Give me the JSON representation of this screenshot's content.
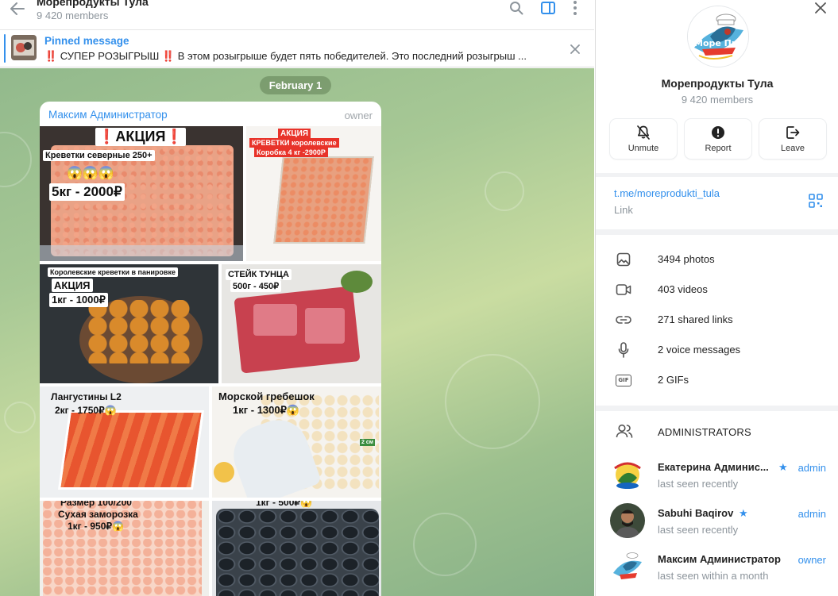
{
  "chat": {
    "title": "Морепродукты Тула",
    "members": "9 420 members",
    "pinned": {
      "title": "Pinned message",
      "text": "‼️ СУПЕР РОЗЫГРЫШ ‼️  В этом розыгрыше будет пять победителей.  Это последний розыгрыш ..."
    },
    "date": "February 1",
    "message": {
      "sender": "Максим Администратор",
      "role": "owner",
      "photos": {
        "p1": {
          "a": "❗АКЦИЯ❗",
          "b": "Креветки северные 250+",
          "c": "😱😱😱",
          "d": "5кг - 2000₽"
        },
        "p2": {
          "a": "АКЦИЯ",
          "b": "КРЕВЕТКИ королевские",
          "c": "Коробка 4 кг -2900Р"
        },
        "p3": {
          "a": "Королевские креветки в панировке",
          "b": "АКЦИЯ",
          "c": "1кг - 1000₽"
        },
        "p4": {
          "a": "СТЕЙК ТУНЦА",
          "b": "500г - 450₽"
        },
        "p5": {
          "a": "Лангустины L2",
          "b": "2кг - 1750₽😱"
        },
        "p6": {
          "a": "Морской гребешок",
          "b": "1кг - 1300₽😱",
          "c": "2 см"
        },
        "p7": {
          "a": "Размер 100/200",
          "b": "Сухая заморозка",
          "c": "1кг - 950₽😱"
        },
        "p8": {
          "a": "1кг - 500₽😱"
        }
      }
    }
  },
  "info": {
    "name": "Морепродукты Тула",
    "members": "9 420 members",
    "avatar_text": "Море Продукты",
    "actions": [
      {
        "label": "Unmute",
        "icon": "bell-off-icon"
      },
      {
        "label": "Report",
        "icon": "alert-icon"
      },
      {
        "label": "Leave",
        "icon": "leave-icon"
      }
    ],
    "link": {
      "url": "t.me/moreprodukti_tula",
      "caption": "Link"
    },
    "media": [
      {
        "label": "3494 photos",
        "icon": "photo-icon"
      },
      {
        "label": "403 videos",
        "icon": "video-icon"
      },
      {
        "label": "271 shared links",
        "icon": "link-icon"
      },
      {
        "label": "2 voice messages",
        "icon": "mic-icon"
      },
      {
        "label": "2 GIFs",
        "icon": "gif-icon"
      }
    ],
    "admins_header": "ADMINISTRATORS",
    "gif_badge": "GIF",
    "admins": [
      {
        "name": "Екатерина Админис...",
        "status": "last seen recently",
        "role": "admin",
        "star": "★"
      },
      {
        "name": "Sabuhi Baqirov",
        "status": "last seen recently",
        "role": "admin",
        "star": "★"
      },
      {
        "name": "Максим Администратор",
        "status": "last seen within a month",
        "role": "owner"
      }
    ]
  },
  "colors": {
    "accent": "#3390ec",
    "muted": "#8d959c",
    "chat_bg": "#a7c895"
  }
}
